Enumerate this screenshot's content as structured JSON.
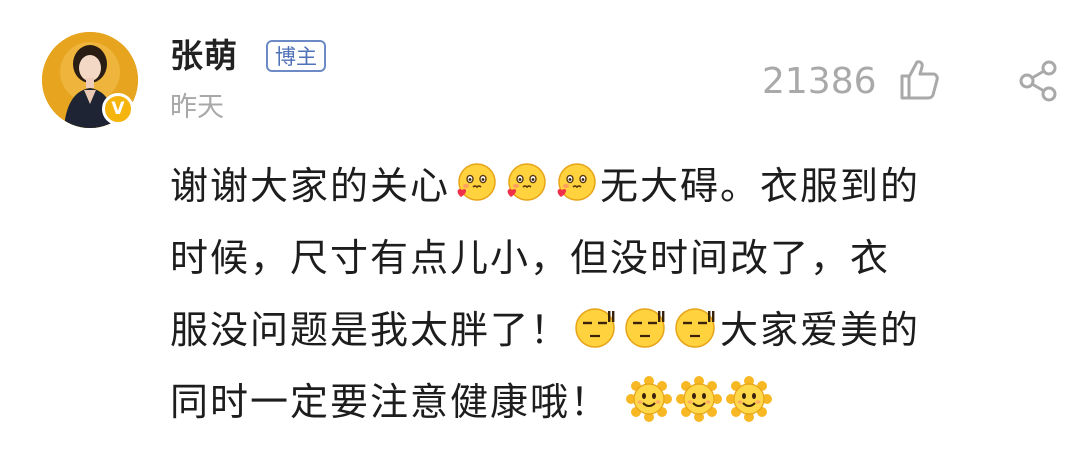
{
  "comment": {
    "author": {
      "name": "张萌",
      "badge": "博主",
      "verified_mark": "V",
      "avatar_icon": "avatar-photo"
    },
    "time": "昨天",
    "likes": "21386",
    "like_icon": "thumbs-up-icon",
    "share_icon": "share-icon",
    "content": {
      "line1_text_a": "谢谢大家的关心",
      "line1_text_b": "无大碍。衣服到的",
      "line2_text": "时候，尺寸有点儿小，但没时间改了，衣",
      "line3_text_a": "服没问题是我太胖了！",
      "line3_text_b": "大家爱美的",
      "line4_text": "同时一定要注意健康哦！",
      "emojis": {
        "love_face": "cute-love-emoji",
        "awkward_face": "sweat-awkward-emoji",
        "sun_face": "sun-smile-emoji"
      }
    },
    "colors": {
      "badge_border": "#6d8ac6",
      "verified": "#f6b40e",
      "meta_gray": "#a8a8a8"
    }
  }
}
